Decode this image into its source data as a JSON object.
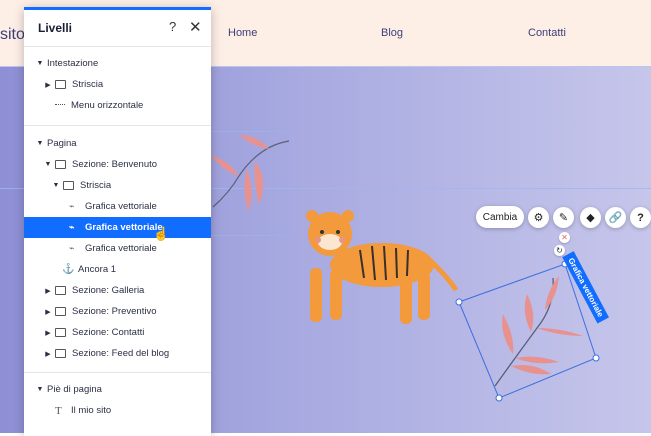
{
  "site": {
    "logo": "sito",
    "nav": [
      "Home",
      "Blog",
      "Contatti"
    ]
  },
  "panel": {
    "title": "Livelli",
    "help": "?",
    "close": "✕",
    "sections": [
      {
        "label": "Intestazione",
        "items": [
          {
            "label": "Striscia",
            "icon": "strip-icon"
          },
          {
            "label": "Menu orizzontale",
            "icon": "menu-icon"
          }
        ]
      },
      {
        "label": "Pagina",
        "items": [
          {
            "label": "Sezione: Benvenuto"
          },
          {
            "label": "Striscia"
          },
          {
            "label": "Grafica vettoriale"
          },
          {
            "label": "Grafica vettoriale",
            "selected": true
          },
          {
            "label": "Grafica vettoriale"
          },
          {
            "label": "Ancora 1"
          },
          {
            "label": "Sezione: Galleria"
          },
          {
            "label": "Sezione: Preventivo"
          },
          {
            "label": "Sezione: Contatti"
          },
          {
            "label": "Sezione: Feed del blog"
          }
        ]
      },
      {
        "label": "Piè di pagina",
        "items": [
          {
            "label": "Il mio sito"
          }
        ]
      }
    ]
  },
  "toolbar": {
    "change_label": "Cambia",
    "settings_icon": "gear-icon",
    "design_icon": "brush-icon",
    "animation_icon": "animation-icon",
    "link_icon": "link-icon",
    "help_icon": "help-icon",
    "help": "?"
  },
  "selection": {
    "badge": "Grafica vettoriale"
  },
  "colors": {
    "accent": "#116dff",
    "canvas_start": "#8e8fd6",
    "canvas_end": "#c6c6eb",
    "header_bg": "#fdeee6",
    "tiger": "#f39a3d",
    "leaf": "#e8928f"
  }
}
